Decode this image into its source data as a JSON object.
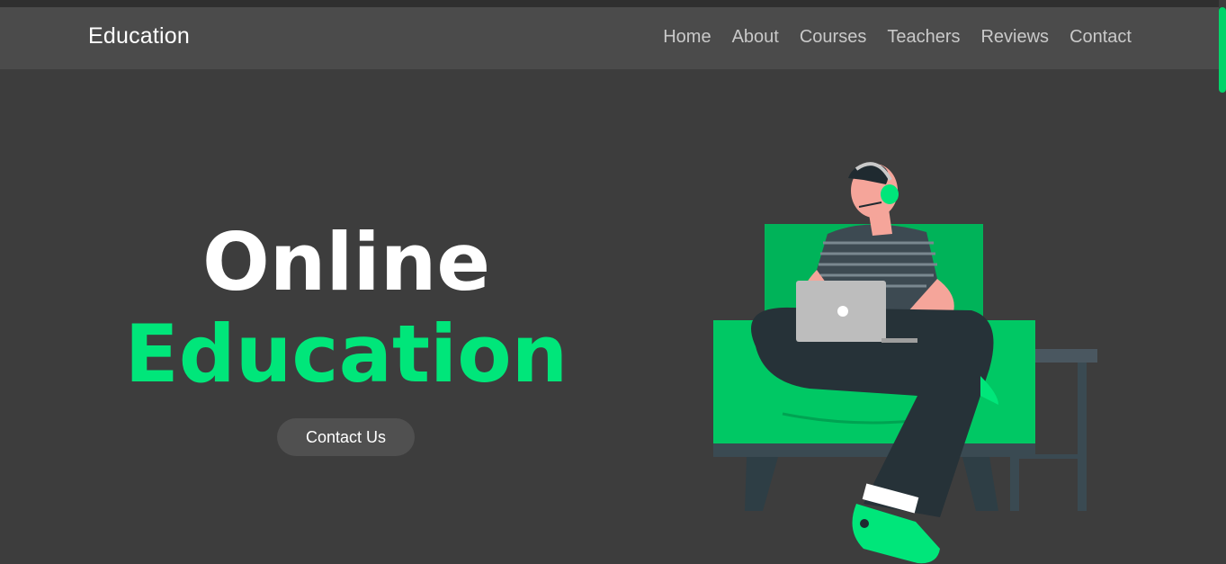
{
  "brand": "Education",
  "nav": [
    "Home",
    "About",
    "Courses",
    "Teachers",
    "Reviews",
    "Contact"
  ],
  "hero": {
    "line1": "Online",
    "line2": "Education",
    "cta": "Contact Us"
  },
  "colors": {
    "accent": "#00e67a",
    "background": "#3d3d3d",
    "navbar": "#4b4b4b"
  },
  "icons": {
    "illustration": "student-on-sofa-with-laptop-illustration"
  }
}
